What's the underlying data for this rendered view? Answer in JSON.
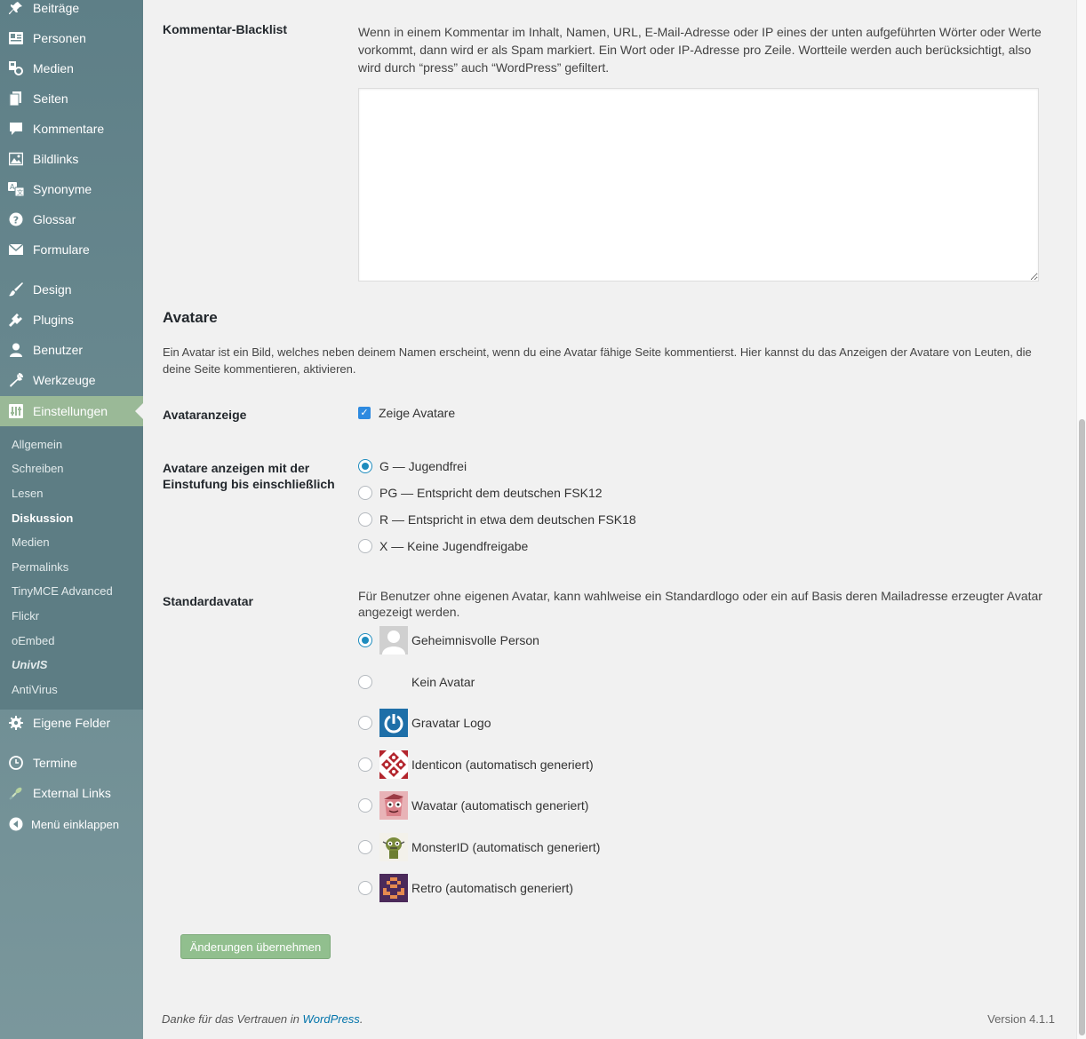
{
  "sidebar": {
    "menu": [
      {
        "label": "Beiträge",
        "icon": "pin-icon"
      },
      {
        "label": "Personen",
        "icon": "person-card-icon"
      },
      {
        "label": "Medien",
        "icon": "media-icon"
      },
      {
        "label": "Seiten",
        "icon": "pages-icon"
      },
      {
        "label": "Kommentare",
        "icon": "comment-icon"
      },
      {
        "label": "Bildlinks",
        "icon": "image-icon"
      },
      {
        "label": "Synonyme",
        "icon": "translate-icon"
      },
      {
        "label": "Glossar",
        "icon": "help-icon"
      },
      {
        "label": "Formulare",
        "icon": "mail-icon"
      },
      {
        "label": "Design",
        "icon": "brush-icon"
      },
      {
        "label": "Plugins",
        "icon": "plugin-icon"
      },
      {
        "label": "Benutzer",
        "icon": "user-icon"
      },
      {
        "label": "Werkzeuge",
        "icon": "wrench-icon"
      },
      {
        "label": "Einstellungen",
        "icon": "settings-icon"
      }
    ],
    "submenu": [
      "Allgemein",
      "Schreiben",
      "Lesen",
      "Diskussion",
      "Medien",
      "Permalinks",
      "TinyMCE Advanced",
      "Flickr",
      "oEmbed",
      "UnivIS",
      "AntiVirus"
    ],
    "current_submenu": "Diskussion",
    "bottom": [
      {
        "label": "Eigene Felder",
        "icon": "gear-icon"
      },
      {
        "label": "Termine",
        "icon": "clock-icon"
      },
      {
        "label": "External Links",
        "icon": "link-icon"
      },
      {
        "label": "Menü einklappen",
        "icon": "collapse-icon"
      }
    ]
  },
  "blacklist": {
    "label": "Kommentar-Blacklist",
    "description": "Wenn in einem Kommentar im Inhalt, Namen, URL, E-Mail-Adresse oder IP eines der unten aufgeführten Wörter oder Werte vorkommt, dann wird er als Spam markiert. Ein Wort oder IP-Adresse pro Zeile. Wortteile werden auch berücksichtigt, also wird durch “press” auch “WordPress” gefiltert.",
    "value": ""
  },
  "avatars": {
    "title": "Avatare",
    "intro": "Ein Avatar ist ein Bild, welches neben deinem Namen erscheint, wenn du eine Avatar fähige Seite kommentierst. Hier kannst du das Anzeigen der Avatare von Leuten, die deine Seite kommentieren, aktivieren.",
    "display_label": "Avataranzeige",
    "show_label": "Zeige Avatare",
    "show_checked": true,
    "rating_label": "Avatare anzeigen mit der Einstufung bis einschließlich",
    "ratings": [
      {
        "label": "G — Jugendfrei",
        "checked": true
      },
      {
        "label": "PG — Entspricht dem deutschen FSK12",
        "checked": false
      },
      {
        "label": "R — Entspricht in etwa dem deutschen FSK18",
        "checked": false
      },
      {
        "label": "X — Keine Jugendfreigabe",
        "checked": false
      }
    ],
    "default_label": "Standardavatar",
    "default_desc": "Für Benutzer ohne eigenen Avatar, kann wahlweise ein Standardlogo oder ein auf Basis deren Mailadresse erzeugter Avatar angezeigt werden.",
    "defaults": [
      {
        "label": "Geheimnisvolle Person",
        "checked": true,
        "icon": "mystery-person-avatar"
      },
      {
        "label": "Kein Avatar",
        "checked": false,
        "icon": ""
      },
      {
        "label": "Gravatar Logo",
        "checked": false,
        "icon": "gravatar-logo-avatar"
      },
      {
        "label": "Identicon (automatisch generiert)",
        "checked": false,
        "icon": "identicon-avatar"
      },
      {
        "label": "Wavatar (automatisch generiert)",
        "checked": false,
        "icon": "wavatar-avatar"
      },
      {
        "label": "MonsterID (automatisch generiert)",
        "checked": false,
        "icon": "monsterid-avatar"
      },
      {
        "label": "Retro (automatisch generiert)",
        "checked": false,
        "icon": "retro-avatar"
      }
    ]
  },
  "submit_label": "Änderungen übernehmen",
  "footer": {
    "thanks_prefix": "Danke für das Vertrauen in",
    "thanks_link": "WordPress",
    "thanks_suffix": ".",
    "version": "Version 4.1.1"
  },
  "colors": {
    "sidebar": "#6e8d93",
    "active": "#9ab997",
    "radio": "#1e8cbe",
    "button": "#91bf8e",
    "link": "#0073aa"
  }
}
